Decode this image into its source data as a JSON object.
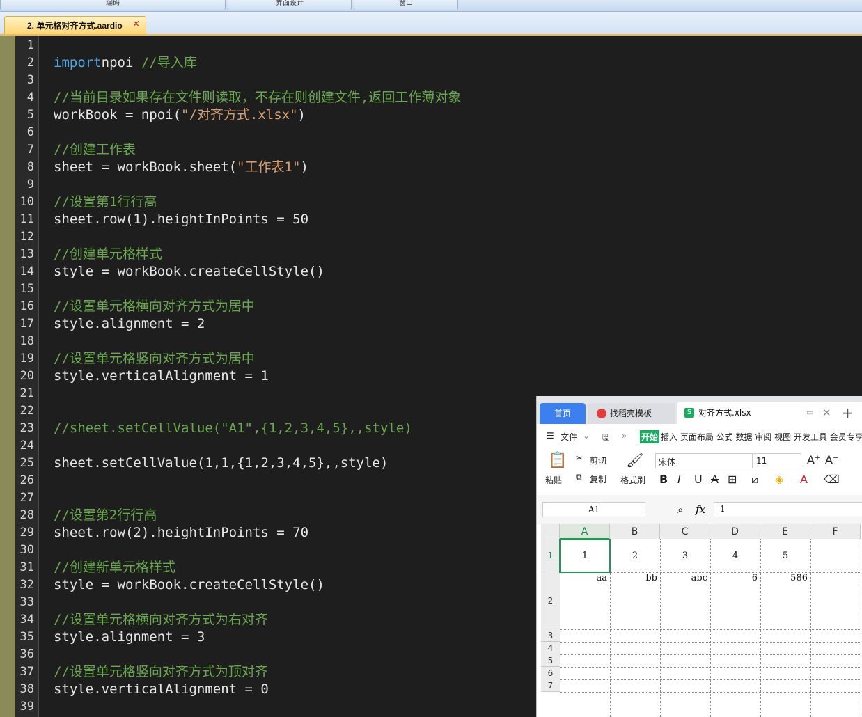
{
  "menubar": {
    "items": [
      "编码",
      "界面设计",
      "窗口"
    ]
  },
  "tab": {
    "title": "2. 单元格对齐方式.aardio",
    "close": "×"
  },
  "code_lines": [
    [],
    [
      [
        "kw",
        "import"
      ],
      [
        "",
        "npoi "
      ],
      [
        "cm",
        "//导入库"
      ]
    ],
    [],
    [
      [
        "cm",
        "//当前目录如果存在文件则读取，不存在则创建文件,返回工作薄对象"
      ]
    ],
    [
      [
        "",
        "workBook = npoi("
      ],
      [
        "st",
        "\"/对齐方式.xlsx\""
      ],
      [
        "",
        ")"
      ]
    ],
    [],
    [
      [
        "cm",
        "//创建工作表"
      ]
    ],
    [
      [
        "",
        "sheet = workBook.sheet("
      ],
      [
        "st",
        "\"工作表1\""
      ],
      [
        "",
        ")"
      ]
    ],
    [],
    [
      [
        "cm",
        "//设置第1行行高"
      ]
    ],
    [
      [
        "",
        "sheet.row(1).heightInPoints = 50"
      ]
    ],
    [],
    [
      [
        "cm",
        "//创建单元格样式"
      ]
    ],
    [
      [
        "",
        "style = workBook.createCellStyle()"
      ]
    ],
    [],
    [
      [
        "cm",
        "//设置单元格横向对齐方式为居中"
      ]
    ],
    [
      [
        "",
        "style.alignment = 2"
      ]
    ],
    [],
    [
      [
        "cm",
        "//设置单元格竖向对齐方式为居中"
      ]
    ],
    [
      [
        "",
        "style.verticalAlignment = 1"
      ]
    ],
    [],
    [],
    [
      [
        "cm",
        "//sheet.setCellValue(\"A1\",{1,2,3,4,5},,style)"
      ]
    ],
    [],
    [
      [
        "",
        "sheet.setCellValue(1,1,{1,2,3,4,5},,style)"
      ]
    ],
    [],
    [],
    [
      [
        "cm",
        "//设置第2行行高"
      ]
    ],
    [
      [
        "",
        "sheet.row(2).heightInPoints = 70"
      ]
    ],
    [],
    [
      [
        "cm",
        "//创建新单元格样式"
      ]
    ],
    [
      [
        "",
        "style = workBook.createCellStyle()"
      ]
    ],
    [],
    [
      [
        "cm",
        "//设置单元格横向对齐方式为右对齐"
      ]
    ],
    [
      [
        "",
        "style.alignment = 3"
      ]
    ],
    [],
    [
      [
        "cm",
        "//设置单元格竖向对齐方式为顶对齐"
      ]
    ],
    [
      [
        "",
        "style.verticalAlignment = 0"
      ]
    ],
    []
  ],
  "colors": {
    "keyword": "#4fa8e8",
    "comment": "#6aa84f",
    "string": "#d8a072",
    "wps_green": "#1aab61",
    "wps_blue": "#3c80f0"
  },
  "wps": {
    "tabs": {
      "home": "首页",
      "templates": "找稻壳模板",
      "file": "对齐方式.xlsx",
      "file_icon": "S"
    },
    "menu": {
      "file": "文件",
      "start": "开始",
      "items": "插入 页面布局 公式 数据 审阅 视图 开发工具 会员专享"
    },
    "ribbon": {
      "paste": "粘贴",
      "cut": "剪切",
      "copy": "复制",
      "format_painter": "格式刷",
      "font": "宋体",
      "size": "11"
    },
    "formula_bar": {
      "cell_ref": "A1",
      "fx": "fx",
      "value": "1"
    },
    "columns": [
      "A",
      "B",
      "C",
      "D",
      "E",
      "F"
    ],
    "rows": [
      "1",
      "2",
      "3",
      "4",
      "5",
      "6",
      "7"
    ],
    "row1": [
      "1",
      "2",
      "3",
      "4",
      "5"
    ],
    "row2": [
      "aa",
      "bb",
      "abc",
      "6",
      "586"
    ]
  }
}
